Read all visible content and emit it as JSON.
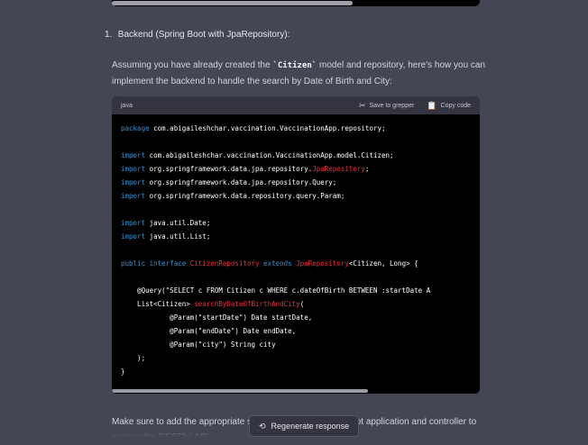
{
  "list": {
    "number": "1.",
    "label": "Backend (Spring Boot with JpaRepository):"
  },
  "intro": {
    "before": "Assuming you have already created the ",
    "code": "`Citizen`",
    "after": " model and repository, here's how you can implement the backend to handle the search by Date of Birth and City:"
  },
  "code_block": {
    "language": "java",
    "save_label": "Save to grepper",
    "copy_label": "Copy code",
    "lines": [
      "package com.abigaileshchar.vaccination.VaccinationApp.repository;",
      "",
      "import com.abigaileshchar.vaccination.VaccinationApp.model.Citizen;",
      "import org.springframework.data.jpa.repository.JpaRepository;",
      "import org.springframework.data.jpa.repository.Query;",
      "import org.springframework.data.repository.query.Param;",
      "",
      "import java.util.Date;",
      "import java.util.List;",
      "",
      "public interface CitizenRepository extends JpaRepository<Citizen, Long> {",
      "",
      "    @Query(\"SELECT c FROM Citizen c WHERE c.dateOfBirth BETWEEN :startDate A",
      "    List<Citizen> searchByDateOfBirthAndCity(",
      "            @Param(\"startDate\") Date startDate,",
      "            @Param(\"endDate\") Date endDate,",
      "            @Param(\"city\") String city",
      "    );",
      "}"
    ]
  },
  "outro": "Make sure to add the appropriate s... ations for the Spring Boot application and controller to expose the RESTful API.",
  "regenerate_label": "Regenerate response",
  "icons": {
    "save": "scissors-icon",
    "copy": "clipboard-icon",
    "regenerate": "refresh-icon"
  }
}
